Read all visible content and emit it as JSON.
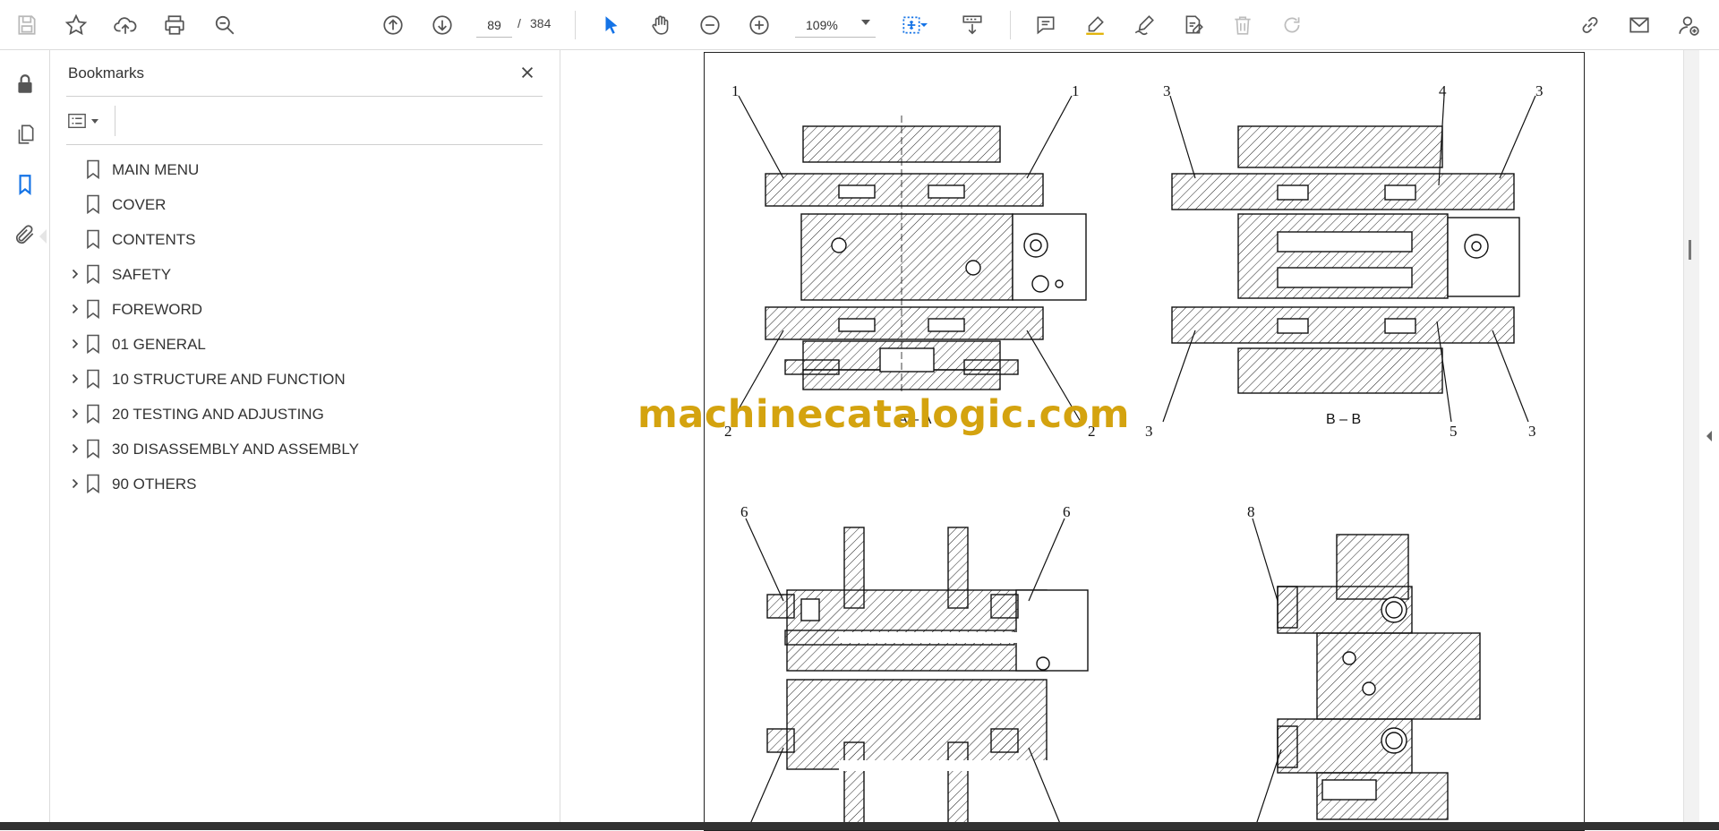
{
  "toolbar": {
    "page_current": "89",
    "page_separator": "/",
    "page_total": "384",
    "zoom": "109%",
    "accent": "#1473e6"
  },
  "icons": {
    "save": "save-icon",
    "star": "star-icon",
    "upload": "upload-icon",
    "print": "print-icon",
    "zoom_search": "find-icon",
    "prev": "previous-page-icon",
    "next": "next-page-icon",
    "select": "select-arrow-icon",
    "hand": "hand-tool-icon",
    "zoom_out": "zoom-out-icon",
    "zoom_in": "zoom-in-icon"
  },
  "bookmarks_panel": {
    "title": "Bookmarks",
    "items": [
      {
        "label": "MAIN MENU",
        "expandable": false
      },
      {
        "label": "COVER",
        "expandable": false
      },
      {
        "label": "CONTENTS",
        "expandable": false
      },
      {
        "label": "SAFETY",
        "expandable": true
      },
      {
        "label": "FOREWORD",
        "expandable": true
      },
      {
        "label": "01 GENERAL",
        "expandable": true
      },
      {
        "label": "10 STRUCTURE AND FUNCTION",
        "expandable": true
      },
      {
        "label": "20 TESTING AND ADJUSTING",
        "expandable": true
      },
      {
        "label": "30 DISASSEMBLY AND ASSEMBLY",
        "expandable": true
      },
      {
        "label": "90 OTHERS",
        "expandable": true
      }
    ]
  },
  "document": {
    "watermark": "machinecatalogic.com",
    "watermark_color": "#d4a30f",
    "section_a": "A – A",
    "section_b": "B – B",
    "callouts": {
      "c1": "1",
      "c2": "2",
      "c3": "3",
      "c4": "4",
      "c5": "5",
      "c6": "6",
      "c8": "8"
    }
  }
}
